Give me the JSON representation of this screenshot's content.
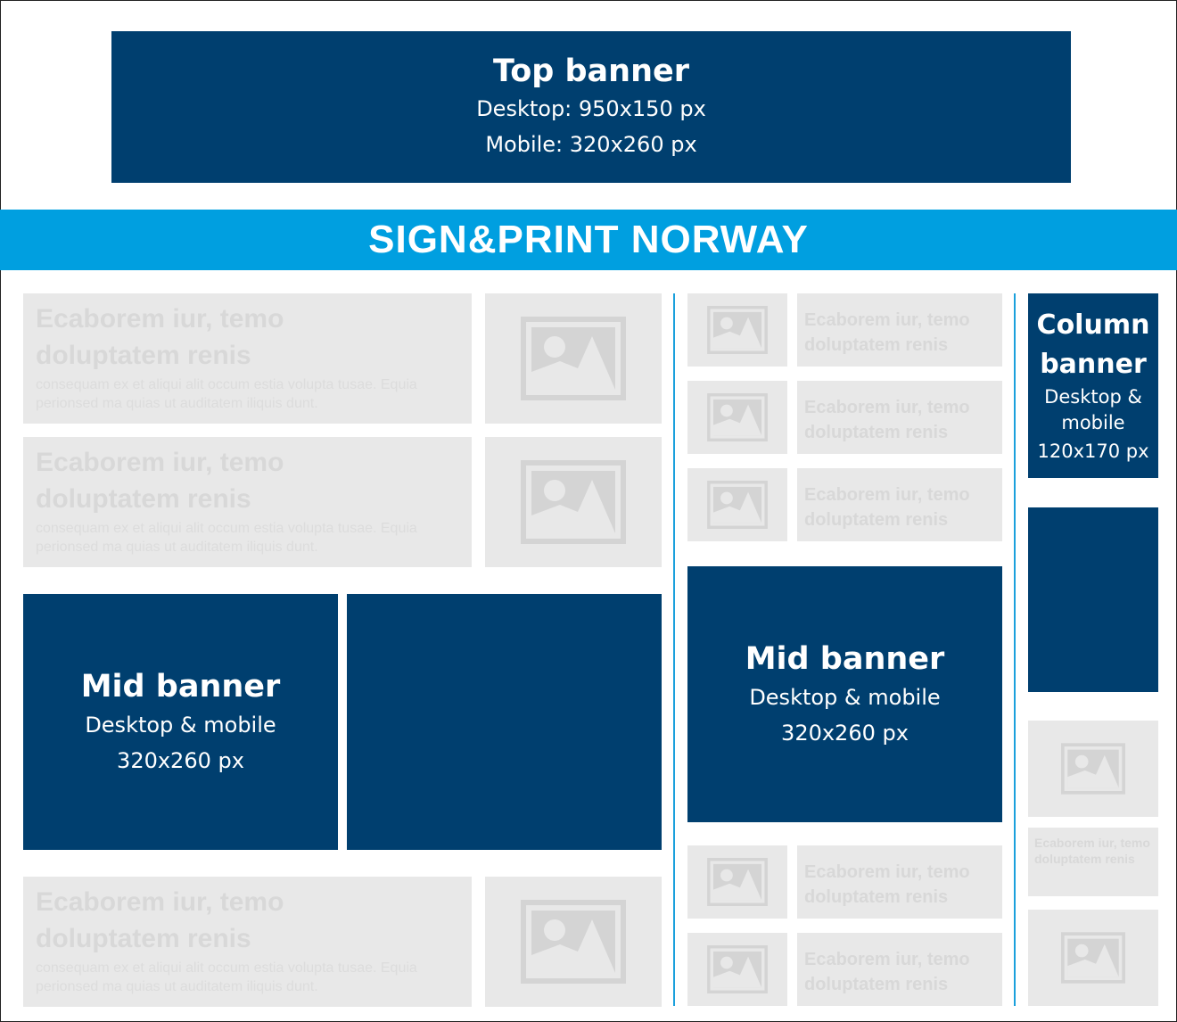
{
  "top_banner": {
    "title": "Top banner",
    "line1": "Desktop: 950x150 px",
    "line2": "Mobile: 320x260 px"
  },
  "masthead": {
    "title": "SIGN&PRINT NORWAY"
  },
  "placeholder": {
    "headline": "Ecaborem iur, temo doluptatem renis",
    "body": "consequam ex et aliqui alit occum estia volupta tusae. Equia perionsed ma quias ut auditatem iliquis dunt."
  },
  "mid_banner_left": {
    "title": "Mid banner",
    "line1": "Desktop & mobile",
    "line2": "320x260 px"
  },
  "mid_banner_right": {
    "title": "Mid banner",
    "line1": "Desktop & mobile",
    "line2": "320x260 px"
  },
  "column_banner": {
    "title": "Column banner",
    "line1": "Desktop & mobile",
    "line2": "120x170 px"
  },
  "colors": {
    "navy": "#003f6f",
    "masthead_blue": "#009fe0",
    "placeholder_grey": "#e8e8e8",
    "divider_blue": "#1aa0dc"
  },
  "icons": {
    "image_placeholder": "image-placeholder-icon"
  }
}
